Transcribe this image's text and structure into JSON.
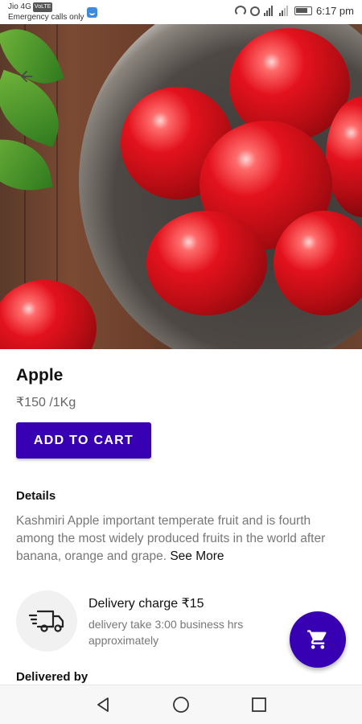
{
  "status_bar": {
    "carrier": "Jio 4G",
    "volte": "VoLTE",
    "emergency": "Emergency calls only",
    "time": "6:17 pm"
  },
  "product": {
    "name": "Apple",
    "price": "₹150 /1Kg",
    "add_to_cart_label": "ADD TO CART"
  },
  "details": {
    "heading": "Details",
    "text": "Kashmiri Apple important temperate fruit and is fourth among the most widely produced fruits in the world after banana, orange and grape. ",
    "see_more": "See More"
  },
  "delivery": {
    "title": "Delivery charge ₹15",
    "subtitle": "delivery take 3:00 business hrs approximately",
    "icon": "delivery-truck-icon"
  },
  "delivered_by": {
    "heading": "Delivered by"
  },
  "colors": {
    "primary": "#3700b3",
    "text_dark": "#111111",
    "text_muted": "#777777"
  },
  "nav": {
    "back": "back-triangle-icon",
    "home": "home-circle-icon",
    "recents": "recents-square-icon"
  }
}
